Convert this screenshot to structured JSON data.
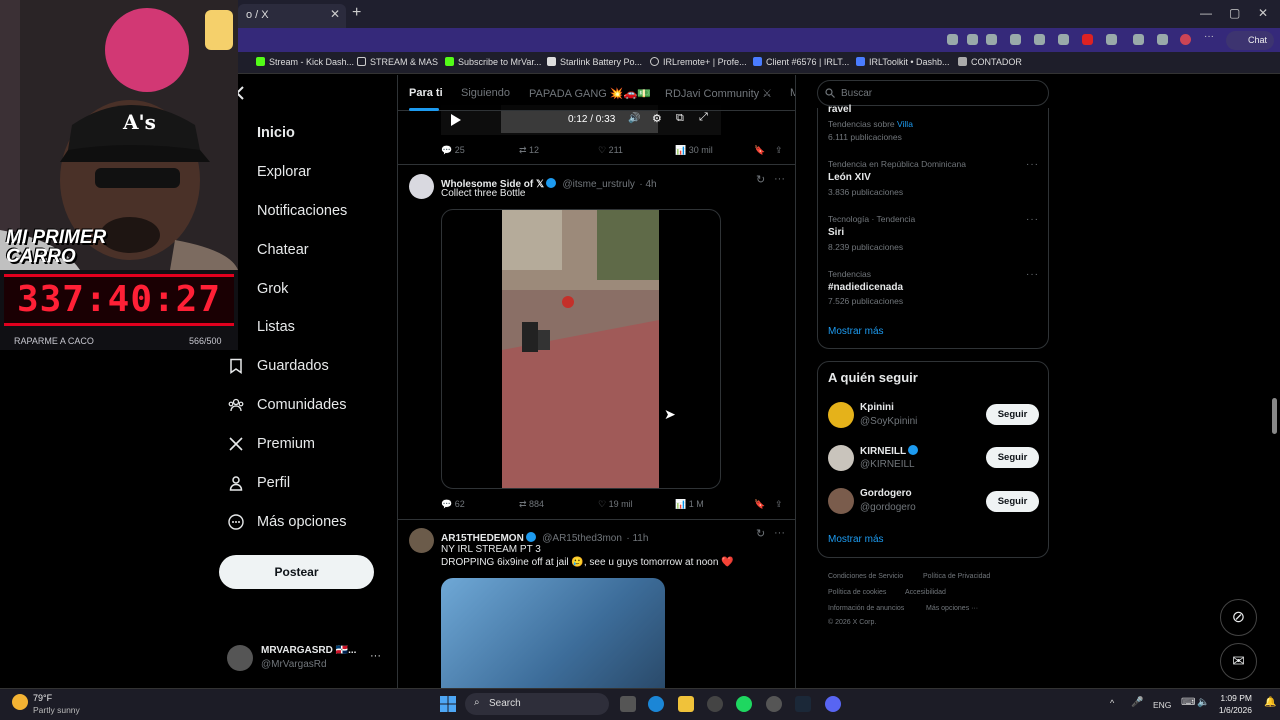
{
  "browser": {
    "tab_title": "o / X",
    "bookmarks": [
      "Stream - Kick Dash...",
      "STREAM & MAS",
      "Subscribe to MrVar...",
      "Starlink Battery Po...",
      "IRLremote+ | Profe...",
      "Client #6576 | IRLT...",
      "IRLToolkit • Dashb...",
      "CONTADOR"
    ],
    "chat_label": "Chat"
  },
  "overlay": {
    "banner": "MI PRIMER CARRO",
    "timer": "337:40:27",
    "goal_label": "RAPARME A CACO",
    "goal_count": "566/500",
    "cap_text": "A's"
  },
  "nav": {
    "items": [
      "Inicio",
      "Explorar",
      "Notificaciones",
      "Chatear",
      "Grok",
      "Listas",
      "Guardados",
      "Comunidades",
      "Premium",
      "Perfil",
      "Más opciones"
    ],
    "post_button": "Postear",
    "account_name": "MRVARGASRD 🇩🇴...",
    "account_handle": "@MrVargasRd"
  },
  "feed": {
    "tabs": [
      "Para ti",
      "Siguiendo",
      "PAPADA GANG 💥🚗💵",
      "RDJavi Community ⚔",
      "M"
    ],
    "video_time": "0:12 / 0:33",
    "post0_stats": {
      "replies": "25",
      "reposts": "12",
      "likes": "211",
      "views": "30 mil"
    },
    "post1": {
      "name": "Wholesome Side of 𝕏",
      "handle": "@itsme_urstruly",
      "time": "· 4h",
      "text": "Collect three Bottle",
      "stats": {
        "replies": "62",
        "reposts": "884",
        "likes": "19 mil",
        "views": "1 M"
      }
    },
    "post2": {
      "name": "AR15THEDEMON",
      "handle": "@AR15thed3mon",
      "time": "· 11h",
      "line1": "NY IRL STREAM PT 3",
      "line2": "DROPPING 6ix9ine off at jail 🥲, see u guys tomorrow at noon ❤️"
    }
  },
  "sidebar": {
    "search_placeholder": "Buscar",
    "trends": [
      {
        "context": "Tendencias sobre",
        "context_link": "Villa",
        "topic": "ravel",
        "count": "6.111 publicaciones"
      },
      {
        "context": "Tendencia en República Dominicana",
        "topic": "León XIV",
        "count": "3.836 publicaciones"
      },
      {
        "context": "Tecnología · Tendencia",
        "topic": "Siri",
        "count": "8.239 publicaciones"
      },
      {
        "context": "Tendencias",
        "topic": "#nadiedicenada",
        "count": "7.526 publicaciones"
      }
    ],
    "show_more": "Mostrar más",
    "who_to_follow_title": "A quién seguir",
    "follow_suggestions": [
      {
        "name": "Kpinini",
        "handle": "@SoyKpinini"
      },
      {
        "name": "KIRNEILL",
        "handle": "@KIRNEILL"
      },
      {
        "name": "Gordogero",
        "handle": "@gordogero"
      }
    ],
    "follow_button": "Seguir",
    "show_more_follow": "Mostrar más",
    "footer": [
      "Condiciones de Servicio",
      "Política de Privacidad",
      "Política de cookies",
      "Accesibilidad",
      "Información de anuncios",
      "Más opciones ···",
      "© 2026 X Corp."
    ]
  },
  "taskbar": {
    "weather_temp": "79°F",
    "weather_desc": "Partly sunny",
    "search_label": "Search",
    "lang": "ENG",
    "time": "1:09 PM",
    "date": "1/6/2026"
  },
  "colors": {
    "accent": "#1d9bf0",
    "timer_red": "#ff2036",
    "address_bar": "#35297a"
  }
}
